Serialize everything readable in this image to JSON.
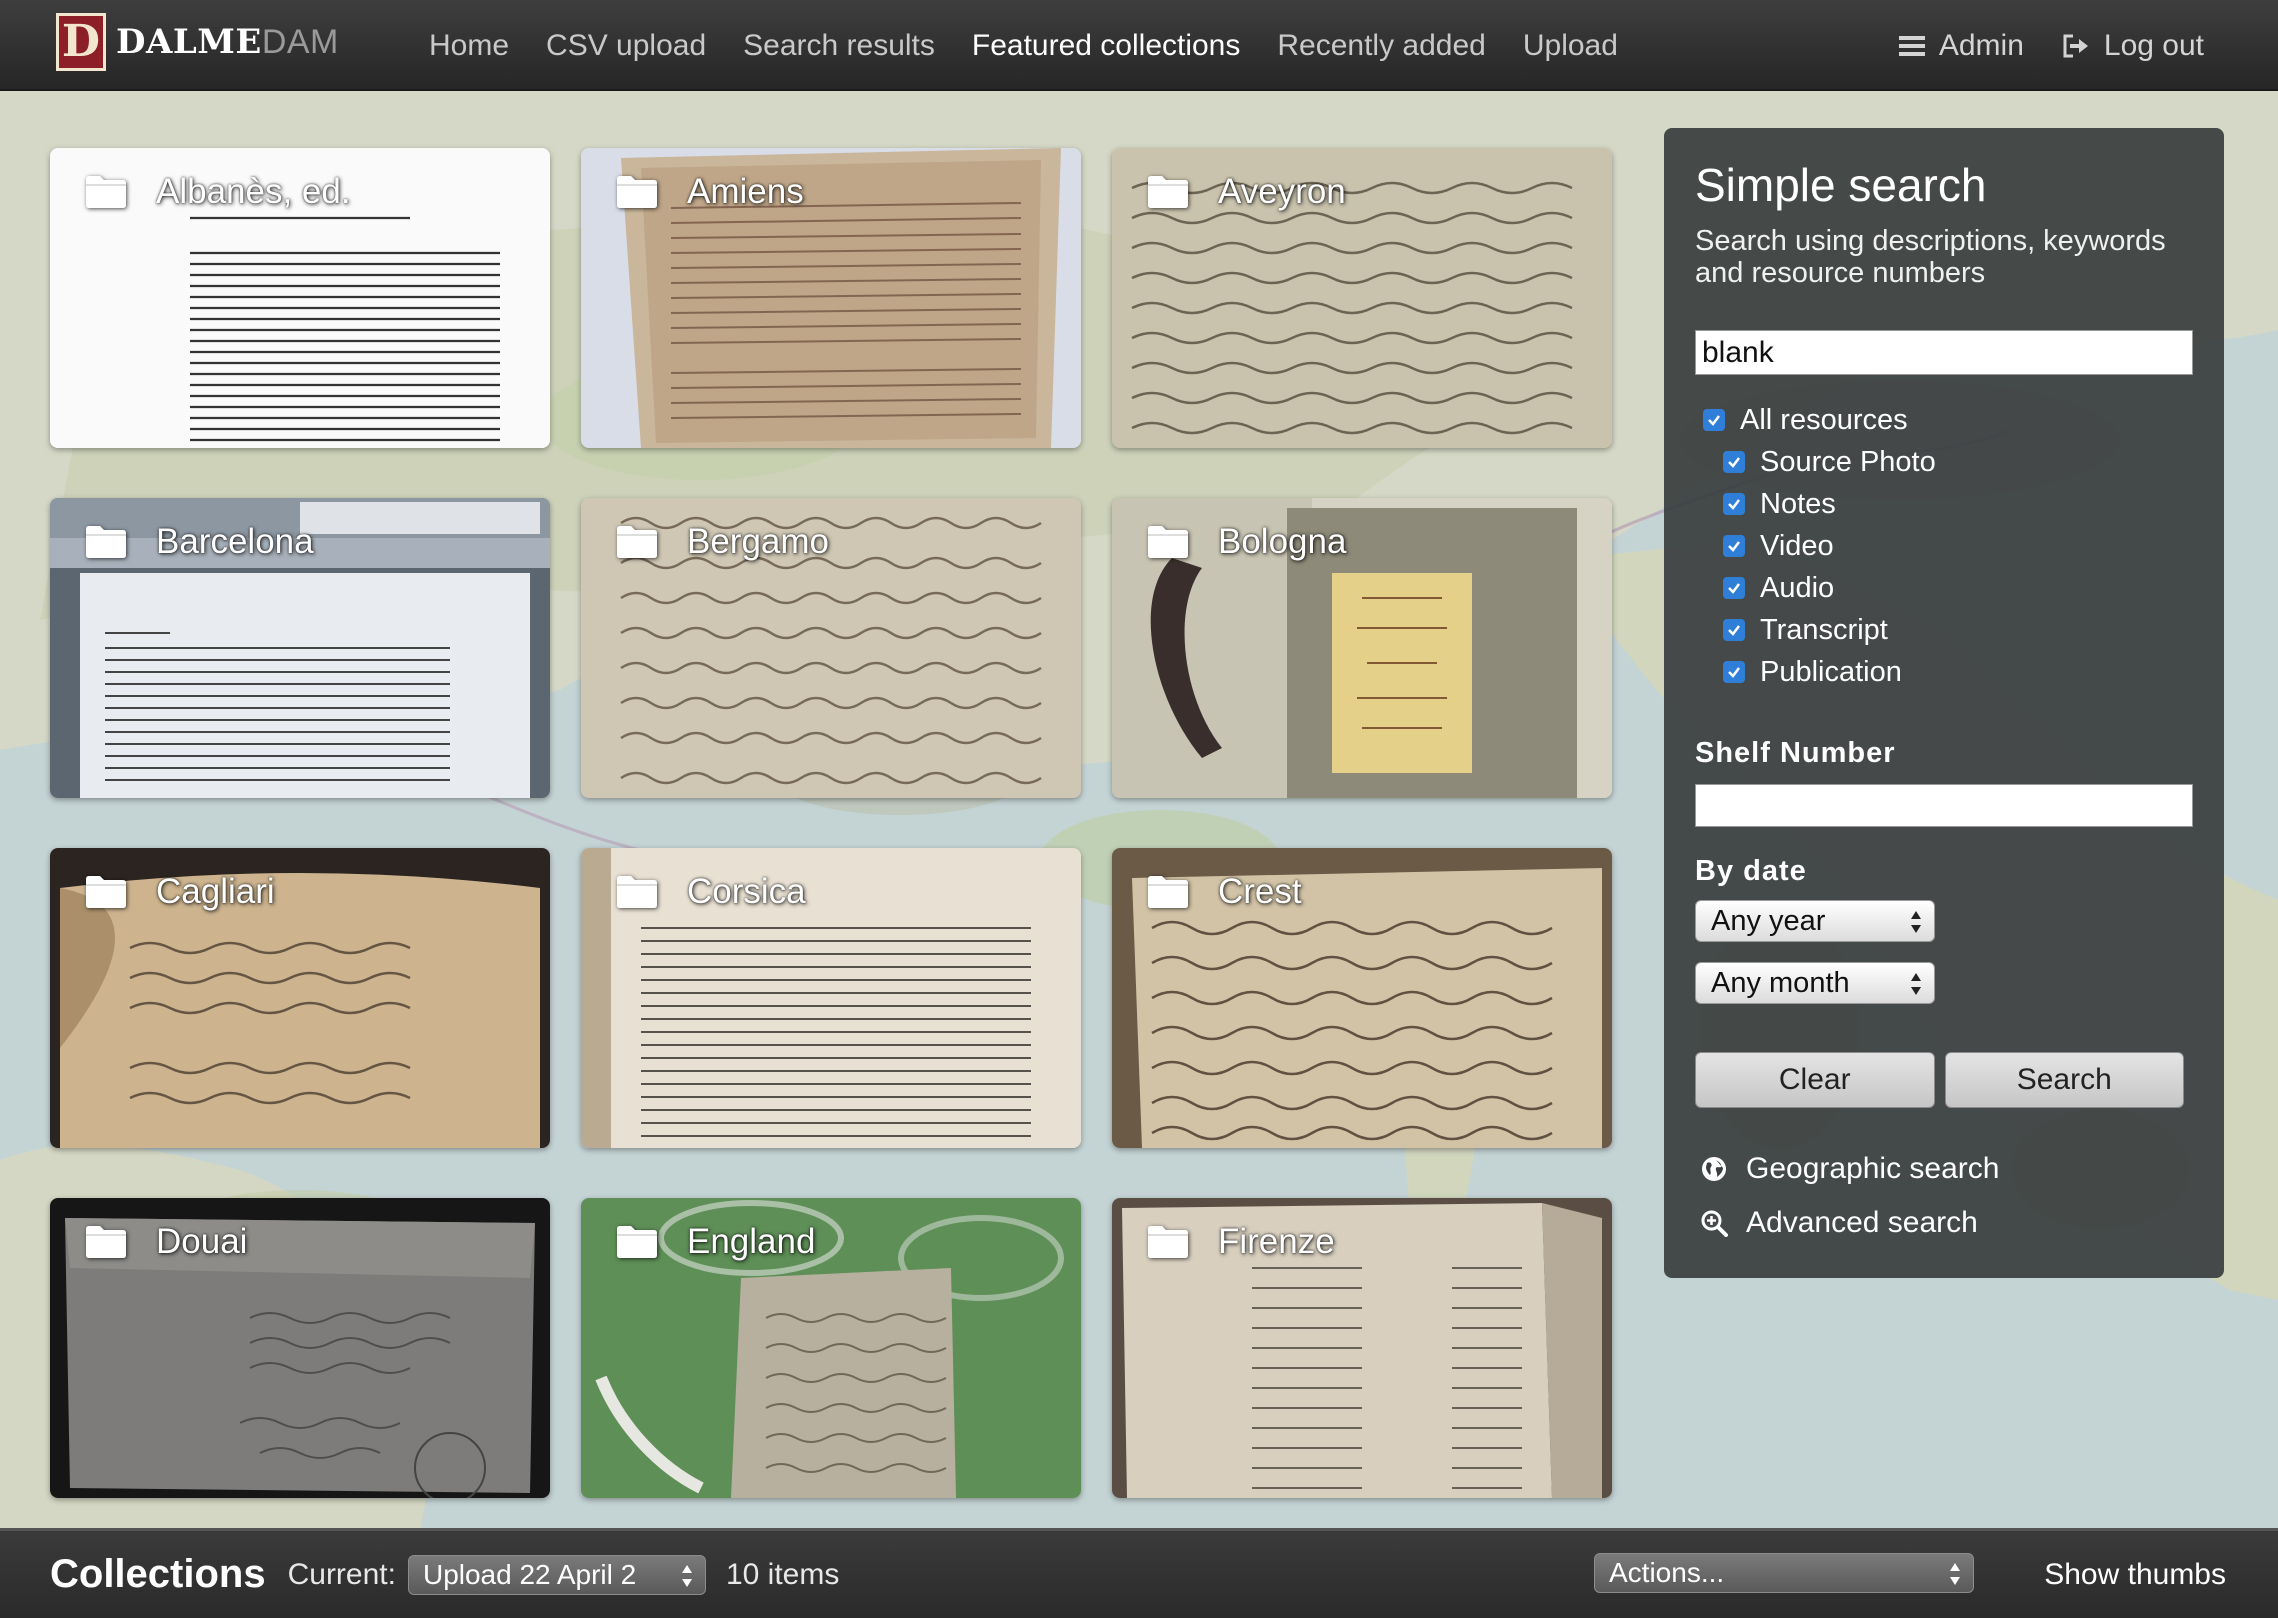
{
  "app": {
    "logo_text_a": "DALME",
    "logo_text_b": "DAM",
    "logo_mark": "D"
  },
  "nav": {
    "items": [
      {
        "label": "Home"
      },
      {
        "label": "CSV upload"
      },
      {
        "label": "Search results"
      },
      {
        "label": "Featured collections",
        "active": true
      },
      {
        "label": "Recently added"
      },
      {
        "label": "Upload"
      }
    ],
    "admin_label": "Admin",
    "logout_label": "Log out",
    "icons": [
      "menu-icon",
      "logout-icon"
    ]
  },
  "collections": [
    {
      "name": "Albanès, ed.",
      "style": "printed-page"
    },
    {
      "name": "Amiens",
      "style": "parchment"
    },
    {
      "name": "Aveyron",
      "style": "manuscript"
    },
    {
      "name": "Barcelona",
      "style": "word-document"
    },
    {
      "name": "Bergamo",
      "style": "manuscript"
    },
    {
      "name": "Bologna",
      "style": "bound-book"
    },
    {
      "name": "Cagliari",
      "style": "old-book"
    },
    {
      "name": "Corsica",
      "style": "printed-book"
    },
    {
      "name": "Crest",
      "style": "manuscript-dark"
    },
    {
      "name": "Douai",
      "style": "grey-parchment"
    },
    {
      "name": "England",
      "style": "green-mat"
    },
    {
      "name": "Firenze",
      "style": "ledger"
    }
  ],
  "search": {
    "title": "Simple search",
    "description": "Search using descriptions, keywords and resource numbers",
    "query": "blank",
    "all_resources_label": "All resources",
    "resource_types": [
      {
        "label": "Source Photo",
        "checked": true
      },
      {
        "label": "Notes",
        "checked": true
      },
      {
        "label": "Video",
        "checked": true
      },
      {
        "label": "Audio",
        "checked": true
      },
      {
        "label": "Transcript",
        "checked": true
      },
      {
        "label": "Publication",
        "checked": true
      }
    ],
    "shelf_number_label": "Shelf Number",
    "shelf_number_value": "",
    "by_date_label": "By date",
    "year_select": "Any year",
    "month_select": "Any month",
    "clear_label": "Clear",
    "search_label": "Search",
    "geographic_search_label": "Geographic search",
    "advanced_search_label": "Advanced search"
  },
  "bottom_bar": {
    "title": "Collections",
    "current_label": "Current:",
    "current_collection": "Upload 22 April 2",
    "item_count": "10 items",
    "actions_label": "Actions...",
    "show_thumbs_label": "Show thumbs"
  },
  "colors": {
    "header_bg": "#2e2e2e",
    "panel_bg": "#3a3e40",
    "checkbox": "#2f7fd8",
    "logo_red": "#8c1f28"
  }
}
